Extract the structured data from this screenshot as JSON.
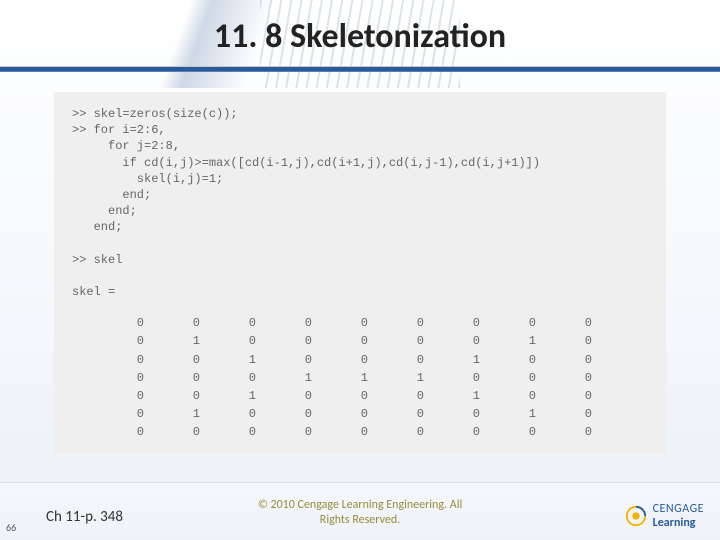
{
  "title": "11. 8 Skeletonization",
  "code_lines": [
    ">> skel=zeros(size(c));",
    ">> for i=2:6,",
    "     for j=2:8,",
    "       if cd(i,j)>=max([cd(i-1,j),cd(i+1,j),cd(i,j-1),cd(i,j+1)])",
    "         skel(i,j)=1;",
    "       end;",
    "     end;",
    "   end;",
    "",
    ">> skel",
    "",
    "skel ="
  ],
  "matrix": [
    [
      0,
      0,
      0,
      0,
      0,
      0,
      0,
      0,
      0
    ],
    [
      0,
      1,
      0,
      0,
      0,
      0,
      0,
      1,
      0
    ],
    [
      0,
      0,
      1,
      0,
      0,
      0,
      1,
      0,
      0
    ],
    [
      0,
      0,
      0,
      1,
      1,
      1,
      0,
      0,
      0
    ],
    [
      0,
      0,
      1,
      0,
      0,
      0,
      1,
      0,
      0
    ],
    [
      0,
      1,
      0,
      0,
      0,
      0,
      0,
      1,
      0
    ],
    [
      0,
      0,
      0,
      0,
      0,
      0,
      0,
      0,
      0
    ]
  ],
  "footer": {
    "chapter_ref": "Ch 11-p. 348",
    "slide_num": "66",
    "copyright_line1": "© 2010 Cengage Learning Engineering. All",
    "copyright_line2": "Rights Reserved.",
    "brand_word1": "CENGAGE",
    "brand_word2": "Learning"
  },
  "colors": {
    "accent": "#2a5a9a",
    "code_bg": "#efefef"
  }
}
